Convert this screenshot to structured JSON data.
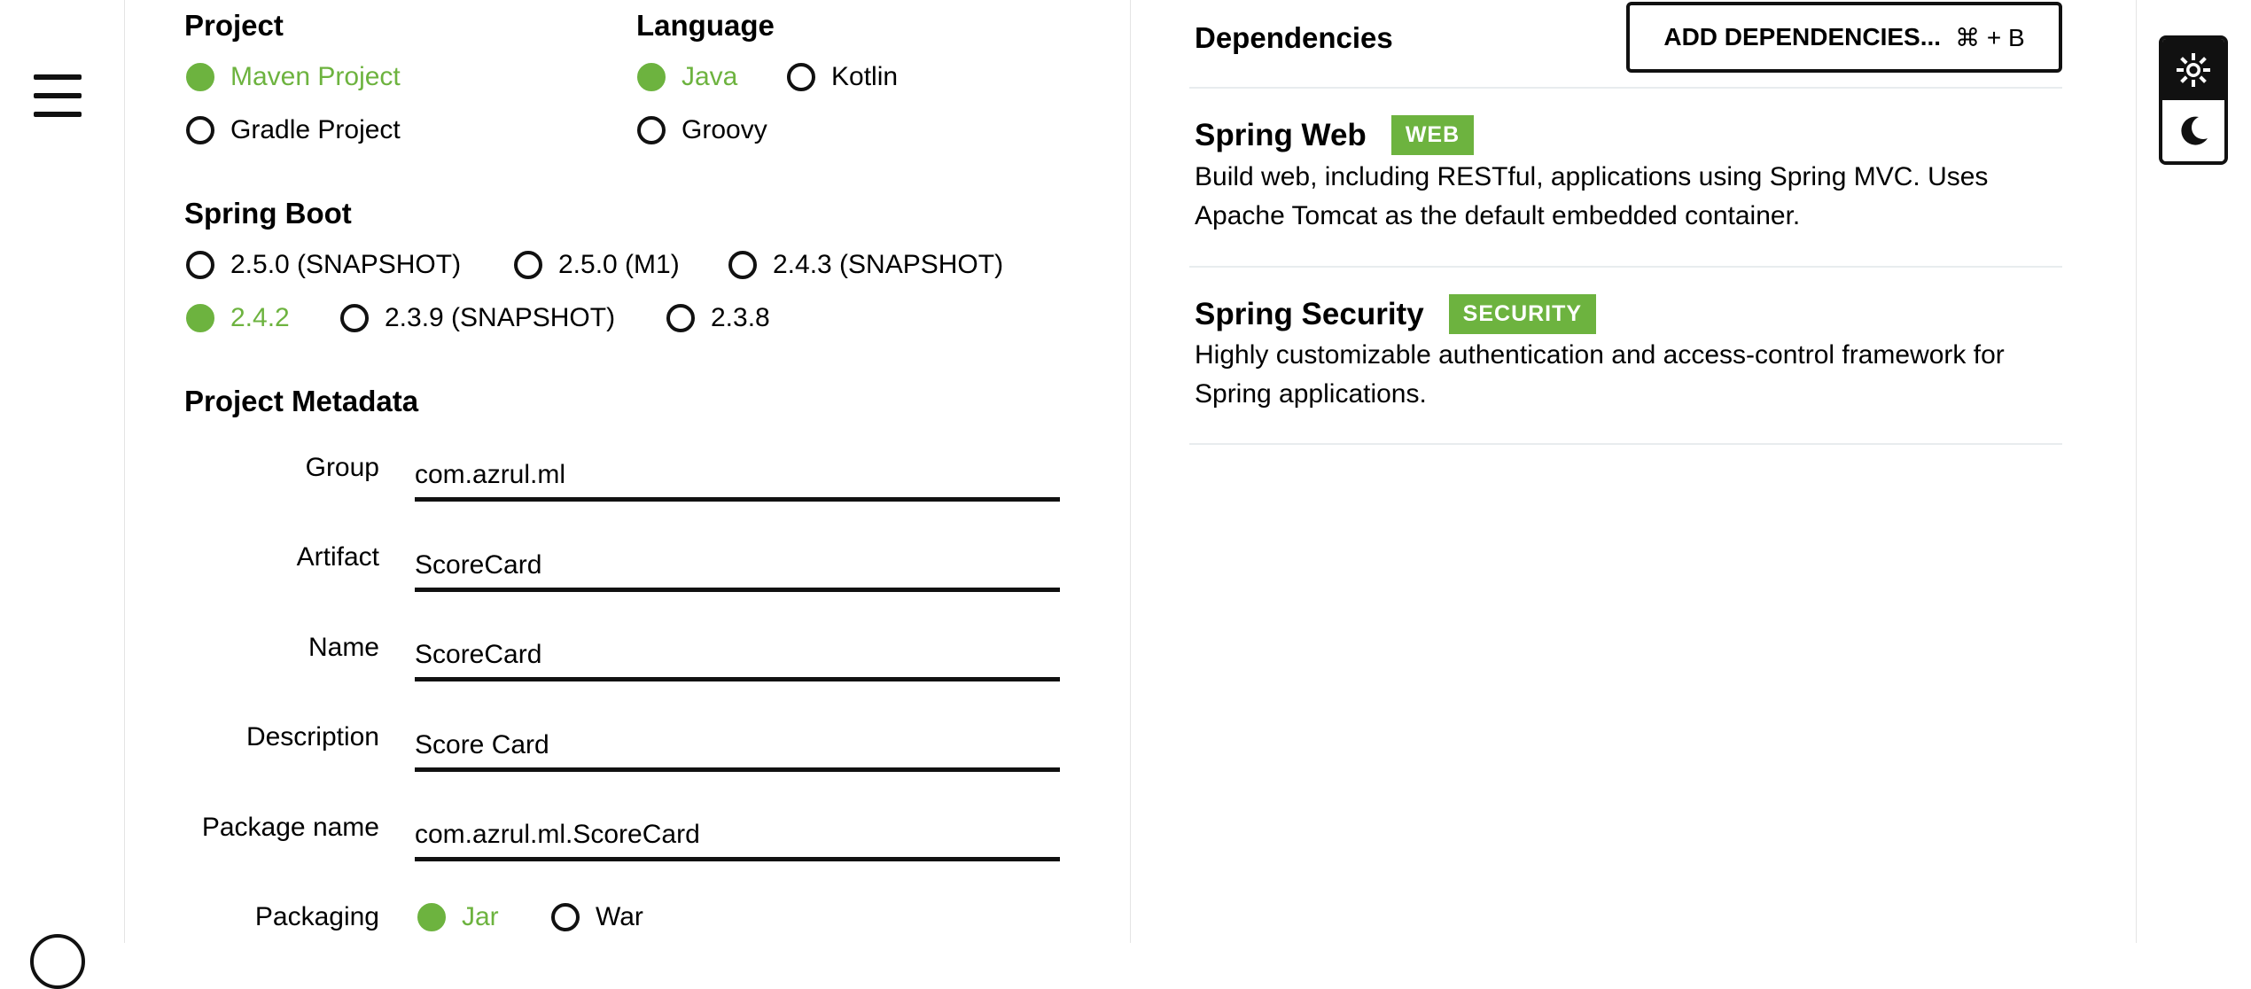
{
  "project": {
    "heading": "Project",
    "options": [
      "Maven Project",
      "Gradle Project"
    ],
    "selected": "Maven Project"
  },
  "language": {
    "heading": "Language",
    "options": [
      "Java",
      "Kotlin",
      "Groovy"
    ],
    "selected": "Java"
  },
  "spring_boot": {
    "heading": "Spring Boot",
    "options": [
      "2.5.0 (SNAPSHOT)",
      "2.5.0 (M1)",
      "2.4.3 (SNAPSHOT)",
      "2.4.2",
      "2.3.9 (SNAPSHOT)",
      "2.3.8"
    ],
    "selected": "2.4.2"
  },
  "metadata": {
    "heading": "Project Metadata",
    "fields": [
      {
        "label": "Group",
        "value": "com.azrul.ml"
      },
      {
        "label": "Artifact",
        "value": "ScoreCard"
      },
      {
        "label": "Name",
        "value": "ScoreCard"
      },
      {
        "label": "Description",
        "value": "Score Card"
      },
      {
        "label": "Package name",
        "value": "com.azrul.ml.ScoreCard"
      }
    ],
    "packaging": {
      "label": "Packaging",
      "options": [
        "Jar",
        "War"
      ],
      "selected": "Jar"
    }
  },
  "dependencies": {
    "heading": "Dependencies",
    "add_button": {
      "label": "ADD DEPENDENCIES...",
      "shortcut": "⌘ + B"
    },
    "items": [
      {
        "title": "Spring Web",
        "badge": "WEB",
        "description": "Build web, including RESTful, applications using Spring MVC. Uses Apache Tomcat as the default embedded container."
      },
      {
        "title": "Spring Security",
        "badge": "SECURITY",
        "description": "Highly customizable authentication and access-control framework for Spring applications."
      }
    ]
  },
  "colors": {
    "accent": "#6db33f",
    "text": "#000000",
    "border": "#111111"
  },
  "icons": {
    "menu": "hamburger-icon",
    "light_theme": "sun-icon",
    "dark_theme": "moon-icon"
  }
}
